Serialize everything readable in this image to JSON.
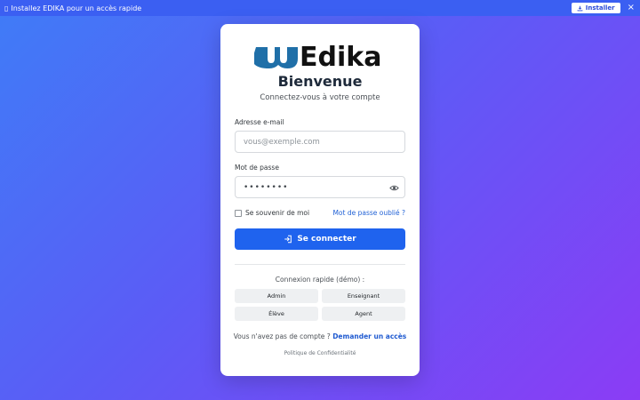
{
  "install_bar": {
    "icon": "app-icon",
    "message": "Installez EDIKA pour un accès rapide",
    "install_label": "Installer",
    "close_label": "×"
  },
  "login": {
    "logo_text": "Edika",
    "title": "Bienvenue",
    "subtitle": "Connectez-vous à votre compte",
    "email_label": "Adresse e-mail",
    "email_placeholder": "vous@exemple.com",
    "password_label": "Mot de passe",
    "password_value": "••••••••",
    "remember_label": "Se souvenir de moi",
    "forgot_label": "Mot de passe oublié ?",
    "submit_label": "Se connecter",
    "quick_label": "Connexion rapide (démo) :",
    "quick_buttons": [
      "Admin",
      "Enseignant",
      "Élève",
      "Agent"
    ],
    "signup_text": "Vous n'avez pas de compte ?",
    "signup_link": "Demander un accès",
    "policy_label": "Politique de Confidentialité"
  },
  "colors": {
    "primary": "#1f63ee",
    "link": "#1f5ad0",
    "logo_blue": "#1f6fa8",
    "logo_dark": "#111111"
  }
}
